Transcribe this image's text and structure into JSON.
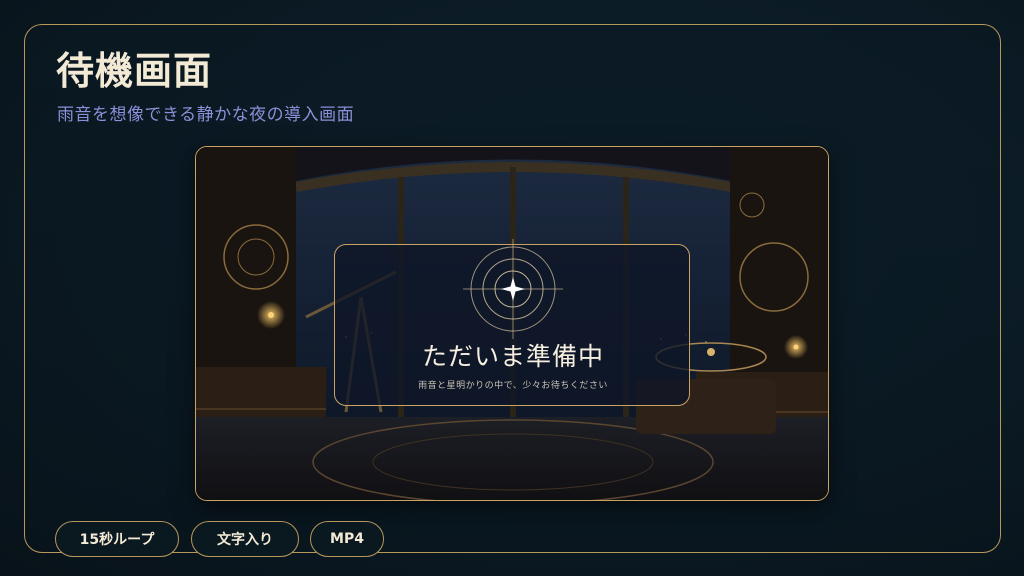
{
  "page": {
    "title": "待機画面",
    "subtitle": "雨音を想像できる静かな夜の導入画面"
  },
  "preview": {
    "title": "ただいま準備中",
    "message": "雨音と星明かりの中で、少々お待ちください",
    "emblem_icon": "compass-star-icon"
  },
  "tags": [
    "15秒ループ",
    "文字入り",
    "MP4"
  ],
  "colors": {
    "gold": "#c9a364",
    "title": "#f3ead6",
    "subtitle": "#8d8fd8",
    "background": "#0b1a24"
  }
}
